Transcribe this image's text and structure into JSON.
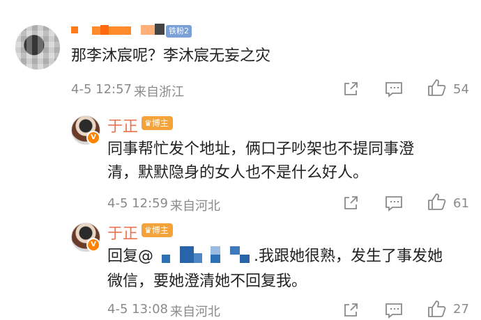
{
  "comments": [
    {
      "user_tag": "铁粉2",
      "text": "那李沐宸呢？李沐宸无妄之灾",
      "date": "4-5 12:57",
      "location": "来自浙江",
      "likes": "54"
    },
    {
      "name": "于正",
      "badge": "博主",
      "verified": "V",
      "line1": "同事帮忙发个地址，俩口子吵架也不提同事澄",
      "line2": "清，默默隐身的女人也不是什么好人。",
      "date": "4-5 12:59",
      "location": "来自河北",
      "likes": "61"
    },
    {
      "name": "于正",
      "badge": "博主",
      "verified": "V",
      "reply_prefix": "回复@",
      "line1_rest": ".我跟她很熟，发生了事发她",
      "line2": "微信，要她澄清她不回复我。",
      "date": "4-5 13:08",
      "location": "来自河北",
      "likes": "27"
    }
  ],
  "colors": {
    "name": "#eb7350",
    "meta": "#8a8a8a",
    "badge": "#f3a33a",
    "tag": "#7aa0d6",
    "mask": "#2f6fb3",
    "mask_orange": "#ff7a1a"
  },
  "icons": [
    "share-icon",
    "comment-icon",
    "like-icon"
  ]
}
